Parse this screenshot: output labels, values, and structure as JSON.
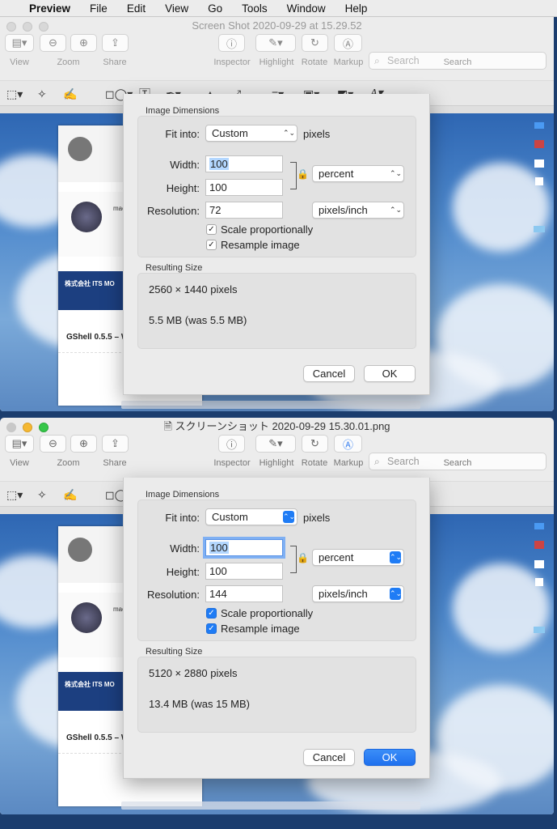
{
  "menubar": {
    "app": "Preview",
    "items": [
      "File",
      "Edit",
      "View",
      "Go",
      "Tools",
      "Window",
      "Help"
    ]
  },
  "toolbar": {
    "view_label": "View",
    "zoom_label": "Zoom",
    "share_label": "Share",
    "inspector_label": "Inspector",
    "highlight_label": "Highlight",
    "rotate_label": "Rotate",
    "markup_label": "Markup",
    "search_label": "Search",
    "search_placeholder": "Search"
  },
  "windows": [
    {
      "title": "Screen Shot 2020-09-29 at 15.29.52",
      "active": false,
      "dialog": {
        "dims_title": "Image Dimensions",
        "fit_label": "Fit into:",
        "fit_value": "Custom",
        "fit_unit": "pixels",
        "width_label": "Width:",
        "width_value": "100",
        "height_label": "Height:",
        "height_value": "100",
        "unit_value": "percent",
        "resolution_label": "Resolution:",
        "resolution_value": "72",
        "resolution_unit": "pixels/inch",
        "scale_label": "Scale proportionally",
        "scale_checked": true,
        "resample_label": "Resample image",
        "resample_checked": true,
        "result_title": "Resulting Size",
        "result_pixels": "2560 × 1440 pixels",
        "result_size": "5.5 MB (was 5.5 MB)",
        "cancel": "Cancel",
        "ok": "OK"
      }
    },
    {
      "title": "スクリーンショット 2020-09-29 15.30.01.png",
      "active": true,
      "dialog": {
        "dims_title": "Image Dimensions",
        "fit_label": "Fit into:",
        "fit_value": "Custom",
        "fit_unit": "pixels",
        "width_label": "Width:",
        "width_value": "100",
        "height_label": "Height:",
        "height_value": "100",
        "unit_value": "percent",
        "resolution_label": "Resolution:",
        "resolution_value": "144",
        "resolution_unit": "pixels/inch",
        "scale_label": "Scale proportionally",
        "scale_checked": true,
        "resample_label": "Resample image",
        "resample_checked": true,
        "result_title": "Resulting Size",
        "result_pixels": "5120 × 2880 pixels",
        "result_size": "13.4 MB (was 15 MB)",
        "cancel": "Cancel",
        "ok": "OK"
      }
    }
  ],
  "background_doc": {
    "company": "株式会社 ITS MO",
    "headline": "GShell 0.5.5 – W",
    "app_name": "mac"
  }
}
